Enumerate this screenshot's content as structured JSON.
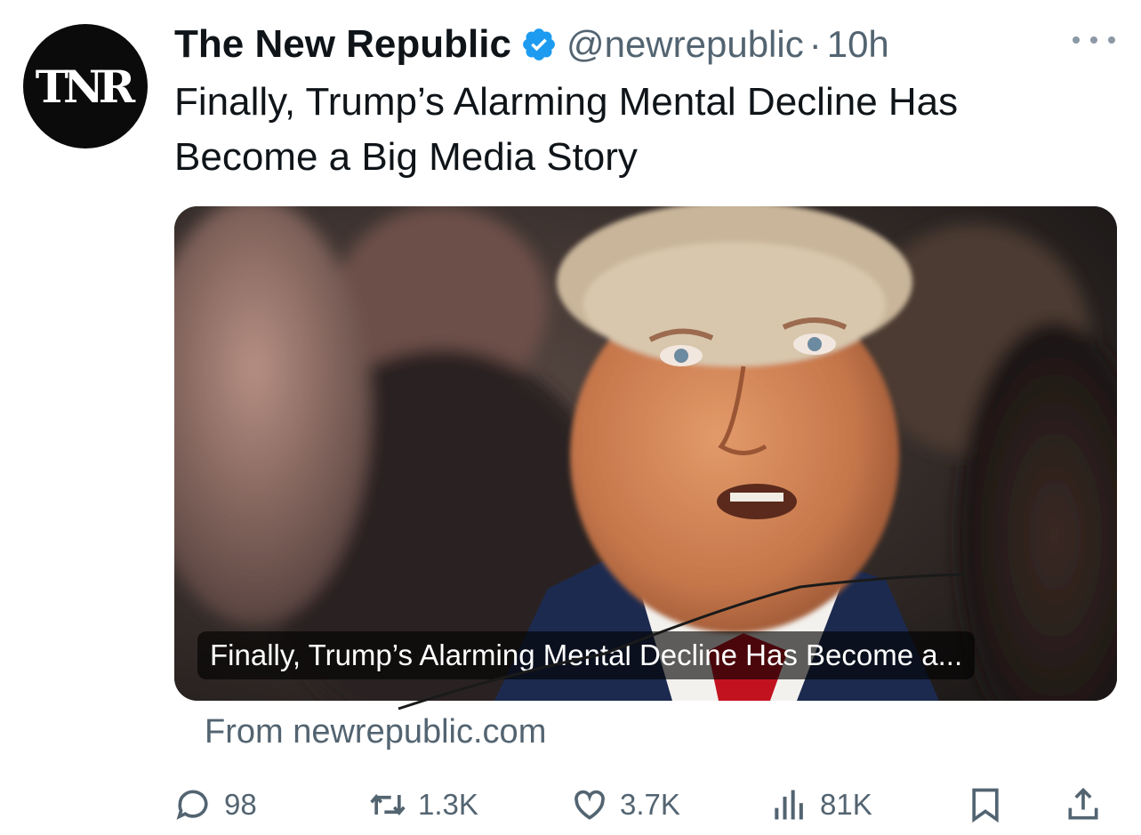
{
  "author": {
    "avatar_text": "TNR",
    "display_name": "The New Republic",
    "handle": "@newrepublic",
    "separator": "·",
    "time": "10h",
    "verified_color": "#1d9bf0"
  },
  "tweet": {
    "text": "Finally, Trump’s Alarming Mental Decline Has Become a Big Media Story"
  },
  "card": {
    "caption": "Finally, Trump’s Alarming Mental Decline Has Become a...",
    "source": "From newrepublic.com"
  },
  "actions": {
    "replies": "98",
    "retweets": "1.3K",
    "likes": "3.7K",
    "views": "81K"
  },
  "icons": [
    "verified-badge-icon",
    "more-options-icon",
    "reply-icon",
    "retweet-icon",
    "like-icon",
    "views-icon",
    "bookmark-icon",
    "share-icon"
  ]
}
